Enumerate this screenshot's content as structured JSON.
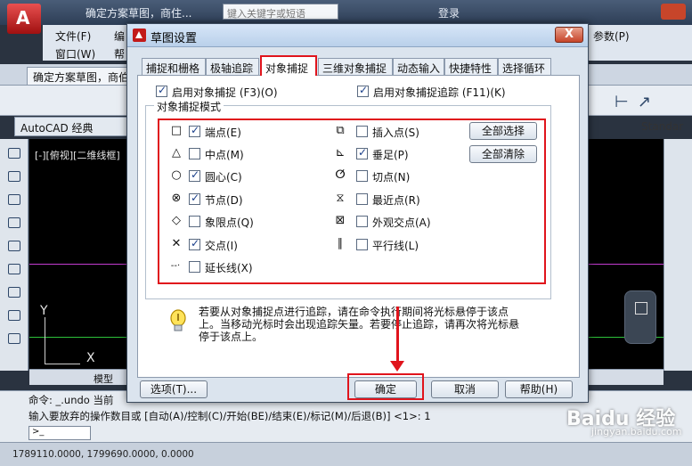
{
  "acad": {
    "search_placeholder": "键入关键字或短语",
    "login_label": "登录",
    "file_name_top": "确定方案草图，商住...",
    "menu_file": "文件(F)",
    "menu_edit": "编",
    "menu_window": "窗口(W)",
    "menu_help": "帮",
    "menu_params": "参数(P)",
    "doc_tab": "确定方案草图，商伯",
    "workspace": "AutoCAD 经典",
    "standard_label": "Standar",
    "view_label": "[-][俯视][二维线框]",
    "ucs_y": "Y",
    "ucs_x": "X",
    "sheet_tab_model": "模型",
    "cmd_line1": "命令: _.undo 当前",
    "cmd_line2": "输入要放弃的操作数目或 [自动(A)/控制(C)/开始(BE)/结束(E)/标记(M)/后退(B)] <1>: 1",
    "cmd_prompt": ">_",
    "coords": "1789110.0000, 1799690.0000, 0.0000",
    "watermark": "Baidu 经验",
    "watermark_sub": "jingyan.baidu.com"
  },
  "dialog": {
    "title": "草图设置",
    "close_label": "X",
    "tabs": [
      {
        "label": "捕捉和栅格",
        "active": false
      },
      {
        "label": "极轴追踪",
        "active": false
      },
      {
        "label": "对象捕捉",
        "active": true
      },
      {
        "label": "三维对象捕捉",
        "active": false
      },
      {
        "label": "动态输入",
        "active": false
      },
      {
        "label": "快捷特性",
        "active": false
      },
      {
        "label": "选择循环",
        "active": false
      }
    ],
    "enable_osnap": {
      "label": "启用对象捕捉 (F3)(O)",
      "checked": true
    },
    "enable_tracking": {
      "label": "启用对象捕捉追踪 (F11)(K)",
      "checked": true
    },
    "group_title": "对象捕捉模式",
    "modes_left": [
      {
        "symbol": "□",
        "label": "端点(E)",
        "checked": true
      },
      {
        "symbol": "△",
        "label": "中点(M)",
        "checked": false
      },
      {
        "symbol": "○",
        "label": "圆心(C)",
        "checked": true
      },
      {
        "symbol": "⊗",
        "label": "节点(D)",
        "checked": true
      },
      {
        "symbol": "◇",
        "label": "象限点(Q)",
        "checked": false
      },
      {
        "symbol": "✕",
        "label": "交点(I)",
        "checked": true
      },
      {
        "symbol": "--·",
        "label": "延长线(X)",
        "checked": false
      }
    ],
    "modes_right": [
      {
        "symbol": "⧉",
        "label": "插入点(S)",
        "checked": false
      },
      {
        "symbol": "⊾",
        "label": "垂足(P)",
        "checked": true
      },
      {
        "symbol": "ⵚ",
        "label": "切点(N)",
        "checked": false
      },
      {
        "symbol": "⧖",
        "label": "最近点(R)",
        "checked": false
      },
      {
        "symbol": "⊠",
        "label": "外观交点(A)",
        "checked": false
      },
      {
        "symbol": "∥",
        "label": "平行线(L)",
        "checked": false
      }
    ],
    "select_all": "全部选择",
    "clear_all": "全部清除",
    "info_text": "若要从对象捕捉点进行追踪，请在命令执行期间将光标悬停于该点上。当移动光标时会出现追踪矢量。若要停止追踪，请再次将光标悬停于该点上。",
    "options_button": "选项(T)...",
    "ok_button": "确定",
    "cancel_button": "取消",
    "help_button": "帮助(H)"
  }
}
